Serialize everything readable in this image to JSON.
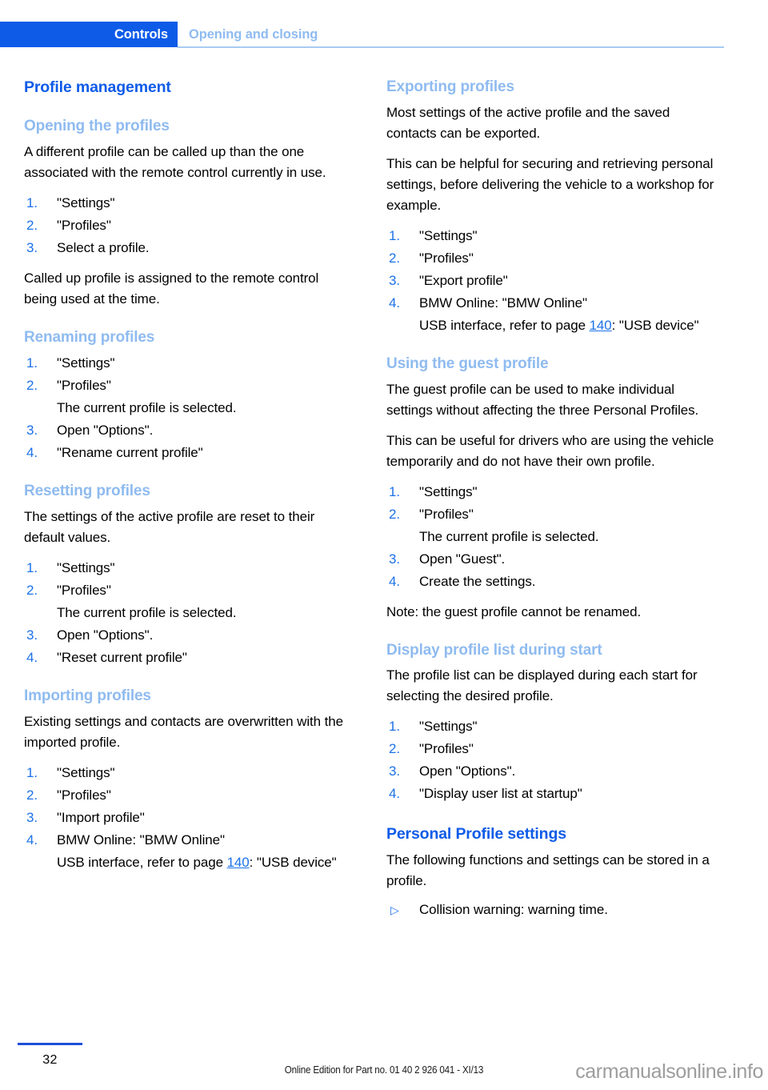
{
  "header": {
    "chapter": "Controls",
    "section": "Opening and closing"
  },
  "left_column": {
    "title": "Profile management",
    "sections": [
      {
        "heading": "Opening the profiles",
        "intro": "A different profile can be called up than the one associated with the remote control currently in use.",
        "steps": [
          {
            "num": "1.",
            "text": "\"Settings\""
          },
          {
            "num": "2.",
            "text": "\"Profiles\""
          },
          {
            "num": "3.",
            "text": "Select a profile."
          }
        ],
        "outro": "Called up profile is assigned to the remote control being used at the time."
      },
      {
        "heading": "Renaming profiles",
        "steps": [
          {
            "num": "1.",
            "text": "\"Settings\""
          },
          {
            "num": "2.",
            "text": "\"Profiles\"",
            "note": "The current profile is selected."
          },
          {
            "num": "3.",
            "text": "Open \"Options\"."
          },
          {
            "num": "4.",
            "text": "\"Rename current profile\""
          }
        ]
      },
      {
        "heading": "Resetting profiles",
        "intro": "The settings of the active profile are reset to their default values.",
        "steps": [
          {
            "num": "1.",
            "text": "\"Settings\""
          },
          {
            "num": "2.",
            "text": "\"Profiles\"",
            "note": "The current profile is selected."
          },
          {
            "num": "3.",
            "text": "Open \"Options\"."
          },
          {
            "num": "4.",
            "text": "\"Reset current profile\""
          }
        ]
      },
      {
        "heading": "Importing profiles",
        "intro": "Existing settings and contacts are overwritten with the imported profile.",
        "steps": [
          {
            "num": "1.",
            "text": "\"Settings\""
          },
          {
            "num": "2.",
            "text": "\"Profiles\""
          },
          {
            "num": "3.",
            "text": "\"Import profile\""
          },
          {
            "num": "4.",
            "text": "BMW Online: \"BMW Online\""
          }
        ],
        "usb_note_before": "USB interface, refer to page ",
        "usb_page": "140",
        "usb_note_after": ": \"USB device\""
      }
    ]
  },
  "right_column": {
    "sections": [
      {
        "heading": "Exporting profiles",
        "intro": "Most settings of the active profile and the saved contacts can be exported.",
        "intro2": "This can be helpful for securing and retrieving personal settings, before delivering the vehicle to a workshop for example.",
        "steps": [
          {
            "num": "1.",
            "text": "\"Settings\""
          },
          {
            "num": "2.",
            "text": "\"Profiles\""
          },
          {
            "num": "3.",
            "text": "\"Export profile\""
          },
          {
            "num": "4.",
            "text": "BMW Online: \"BMW Online\""
          }
        ],
        "usb_note_before": "USB interface, refer to page ",
        "usb_page": "140",
        "usb_note_after": ": \"USB device\""
      },
      {
        "heading": "Using the guest profile",
        "intro": "The guest profile can be used to make individual settings without affecting the three Personal Profiles.",
        "intro2": "This can be useful for drivers who are using the vehicle temporarily and do not have their own profile.",
        "steps": [
          {
            "num": "1.",
            "text": "\"Settings\""
          },
          {
            "num": "2.",
            "text": "\"Profiles\"",
            "note": "The current profile is selected."
          },
          {
            "num": "3.",
            "text": "Open \"Guest\"."
          },
          {
            "num": "4.",
            "text": "Create the settings."
          }
        ],
        "outro": "Note: the guest profile cannot be renamed."
      },
      {
        "heading": "Display profile list during start",
        "intro": "The profile list can be displayed during each start for selecting the desired profile.",
        "steps": [
          {
            "num": "1.",
            "text": "\"Settings\""
          },
          {
            "num": "2.",
            "text": "\"Profiles\""
          },
          {
            "num": "3.",
            "text": "Open \"Options\"."
          },
          {
            "num": "4.",
            "text": "\"Display user list at startup\""
          }
        ]
      },
      {
        "heading": "Personal Profile settings",
        "intro": "The following functions and settings can be stored in a profile.",
        "bullets": [
          {
            "marker": "▷",
            "text": "Collision warning: warning time."
          }
        ]
      }
    ]
  },
  "footer": {
    "page_number": "32",
    "edition": "Online Edition for Part no. 01 40 2 926 041 - XI/13",
    "watermark": "carmanualsonline.info"
  }
}
